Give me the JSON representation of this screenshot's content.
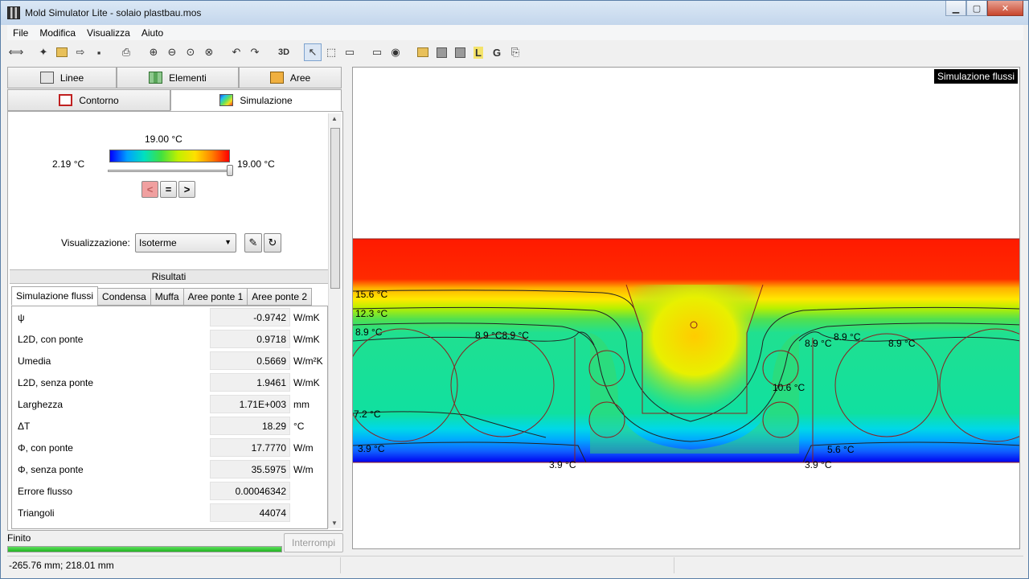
{
  "window": {
    "title": "Mold Simulator Lite - solaio plastbau.mos",
    "min": "▁",
    "max": "▢",
    "close": "✕"
  },
  "menu": [
    "File",
    "Modifica",
    "Visualizza",
    "Aiuto"
  ],
  "toolbar": {
    "btn_3d": "3D"
  },
  "tabs": {
    "row1": [
      "Linee",
      "Elementi",
      "Aree"
    ],
    "row2": [
      "Contorno",
      "Simulazione"
    ]
  },
  "scale": {
    "top": "19.00 °C",
    "min": "2.19 °C",
    "max": "19.00 °C",
    "slider_fraction": 1.0
  },
  "nav": {
    "prev": "<",
    "eq": "=",
    "next": ">"
  },
  "visualizzazione": {
    "label": "Visualizzazione:",
    "value": "Isoterme"
  },
  "results": {
    "header": "Risultati",
    "tabs": [
      "Simulazione flussi",
      "Condensa",
      "Muffa",
      "Aree ponte 1",
      "Aree ponte 2"
    ],
    "rows": [
      {
        "label": "ψ",
        "value": "-0.9742",
        "unit": "W/mK"
      },
      {
        "label": "L2D, con ponte",
        "value": "0.9718",
        "unit": "W/mK"
      },
      {
        "label": "Umedia",
        "value": "0.5669",
        "unit": "W/m²K"
      },
      {
        "label": "L2D, senza ponte",
        "value": "1.9461",
        "unit": "W/mK"
      },
      {
        "label": "Larghezza",
        "value": "1.71E+003",
        "unit": "mm"
      },
      {
        "label": "ΔT",
        "value": "18.29",
        "unit": "°C"
      },
      {
        "label": "Φ, con ponte",
        "value": "17.7770",
        "unit": "W/m"
      },
      {
        "label": "Φ, senza ponte",
        "value": "35.5975",
        "unit": "W/m"
      },
      {
        "label": "Errore flusso",
        "value": "0.00046342",
        "unit": ""
      },
      {
        "label": "Triangoli",
        "value": "44074",
        "unit": ""
      }
    ]
  },
  "status": {
    "text": "Finito",
    "progress": 1.0,
    "stop": "Interrompi",
    "coords": "-265.76 mm; 218.01 mm"
  },
  "canvas": {
    "tag": "Simulazione flussi",
    "labels": [
      "15.6 °C",
      "12.3 °C",
      "8.9 °C",
      "8.9 °C8.9 °C",
      "8.9 °C",
      "8.9 °C",
      "8.9 °C",
      "10.6 °C",
      "7.2 °C",
      "3.9 °C",
      "3.9 °C",
      "3.9 °C",
      "5.6 °C"
    ]
  }
}
